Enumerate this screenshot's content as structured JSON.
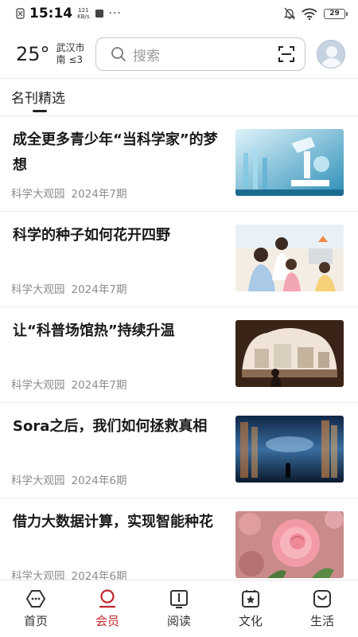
{
  "status_bar": {
    "time": "15:14",
    "speed_value": "121",
    "speed_unit": "KB/s",
    "battery": "29"
  },
  "header": {
    "temperature": "25°",
    "city": "武汉市",
    "wind": "南 ≤3",
    "search_placeholder": "搜索"
  },
  "tabs": [
    {
      "label": "名刊精选",
      "active": true
    }
  ],
  "articles": [
    {
      "title": "成全更多青少年“当科学家”的梦想",
      "source": "科学大观园",
      "date": "2024年7期",
      "thumb": "lab-equipment"
    },
    {
      "title": "科学的种子如何花开四野",
      "source": "科学大观园",
      "date": "2024年7期",
      "thumb": "children-classroom"
    },
    {
      "title": "让“科普场馆热”持续升温",
      "source": "科学大观园",
      "date": "2024年7期",
      "thumb": "science-museum"
    },
    {
      "title": "Sora之后，我们如何拯救真相",
      "source": "科学大观园",
      "date": "2024年6期",
      "thumb": "digital-city"
    },
    {
      "title": "借力大数据计算，实现智能种花",
      "source": "科学大观园",
      "date": "2024年6期",
      "thumb": "pink-roses"
    }
  ],
  "bottom_nav": [
    {
      "label": "首页",
      "icon": "home-icon",
      "active": false
    },
    {
      "label": "会员",
      "icon": "member-icon",
      "active": true
    },
    {
      "label": "阅读",
      "icon": "book-icon",
      "active": false
    },
    {
      "label": "文化",
      "icon": "star-icon",
      "active": false
    },
    {
      "label": "生活",
      "icon": "bag-icon",
      "active": false
    }
  ],
  "colors": {
    "accent": "#c1272d",
    "text": "#1a1a1a",
    "meta": "#8c8c8c"
  }
}
